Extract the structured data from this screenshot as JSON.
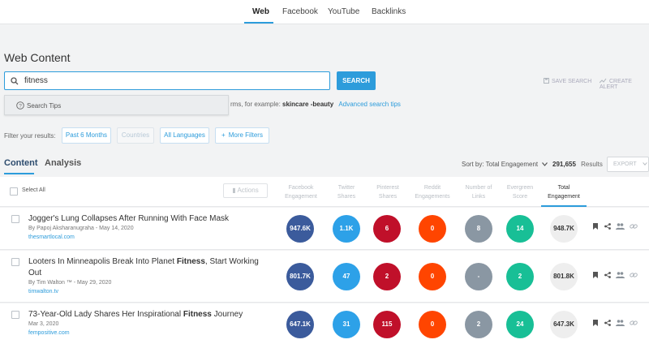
{
  "nav": {
    "tabs": [
      "Web",
      "Facebook",
      "YouTube",
      "Backlinks"
    ]
  },
  "page_title": "Web Content",
  "search": {
    "value": "fitness",
    "button": "SEARCH"
  },
  "save_search": "SAVE SEARCH",
  "create_alert": "CREATE ALERT",
  "dropdown": {
    "search_tips": "Search Tips"
  },
  "hint": {
    "prefix": "rms, for example:",
    "example": "skincare -beauty",
    "advanced": "Advanced search tips"
  },
  "filters": {
    "label": "Filter your results:",
    "date": "Past 6 Months",
    "countries": "Countries",
    "languages": "All Languages",
    "more": "More Filters"
  },
  "subtabs": {
    "content": "Content",
    "analysis": "Analysis"
  },
  "sort": {
    "label": "Sort by: Total Engagement"
  },
  "results": {
    "count": "291,655",
    "label": "Results"
  },
  "export": "EXPORT",
  "table": {
    "select_all": "Select All",
    "actions": "Actions",
    "columns": [
      {
        "l1": "Facebook",
        "l2": "Engagement"
      },
      {
        "l1": "Twitter",
        "l2": "Shares"
      },
      {
        "l1": "Pinterest",
        "l2": "Shares"
      },
      {
        "l1": "Reddit",
        "l2": "Engagements"
      },
      {
        "l1": "Number of",
        "l2": "Links"
      },
      {
        "l1": "Evergreen",
        "l2": "Score"
      },
      {
        "l1": "Total",
        "l2": "Engagement"
      }
    ],
    "rows": [
      {
        "title_before": "Jogger's Lung Collapses After Running With Face Mask",
        "title_bold": "",
        "title_after": "",
        "byline": "By Papoj Aksharanugraha - May 14, 2020",
        "source": "thesmartlocal.com",
        "values": [
          "947.6K",
          "1.1K",
          "6",
          "0",
          "8",
          "14",
          "948.7K"
        ]
      },
      {
        "title_before": "Looters In Minneapolis Break Into Planet ",
        "title_bold": "Fitness",
        "title_after": ", Start Working Out",
        "byline": "By Tim Walton ™ - May 29, 2020",
        "source": "timwalton.tv",
        "values": [
          "801.7K",
          "47",
          "2",
          "0",
          "-",
          "2",
          "801.8K"
        ]
      },
      {
        "title_before": "73-Year-Old Lady Shares Her Inspirational ",
        "title_bold": "Fitness",
        "title_after": " Journey",
        "byline": "Mar 3, 2020",
        "source": "fempositive.com",
        "values": [
          "647.1K",
          "31",
          "115",
          "0",
          "2",
          "24",
          "647.3K"
        ]
      }
    ]
  },
  "colors": {
    "accent": "#2d9cdb",
    "facebook": "#3b5b9c",
    "twitter": "#2da1e8",
    "pinterest": "#c0102a",
    "reddit": "#ff4500",
    "links": "#8a97a3",
    "evergreen": "#18bf96",
    "total": "#eeeeee"
  }
}
